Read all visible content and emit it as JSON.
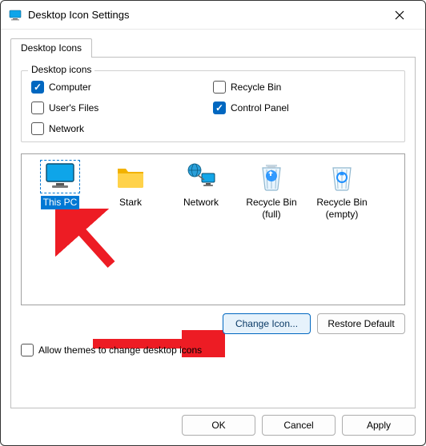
{
  "window": {
    "title": "Desktop Icon Settings"
  },
  "tab": {
    "label": "Desktop Icons"
  },
  "group": {
    "legend": "Desktop icons",
    "checks": {
      "computer": "Computer",
      "usersfiles": "User's Files",
      "network": "Network",
      "recyclebin": "Recycle Bin",
      "controlpanel": "Control Panel"
    }
  },
  "icons": {
    "thispc": "This PC",
    "stark": "Stark",
    "network": "Network",
    "recyclefull": "Recycle Bin\n(full)",
    "recycleempty": "Recycle Bin\n(empty)"
  },
  "buttons": {
    "changeicon": "Change Icon...",
    "restoredefault": "Restore Default",
    "ok": "OK",
    "cancel": "Cancel",
    "apply": "Apply"
  },
  "allowthemes": "Allow themes to change desktop icons"
}
